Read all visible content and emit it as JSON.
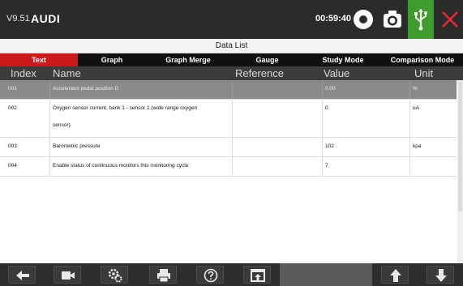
{
  "topbar": {
    "version": "V9.51",
    "make": "AUDI",
    "time": "00:59:40"
  },
  "title": "Data List",
  "tabs": [
    {
      "label": "Text",
      "active": true
    },
    {
      "label": "Graph",
      "active": false
    },
    {
      "label": "Graph Merge",
      "active": false
    },
    {
      "label": "Gauge",
      "active": false
    },
    {
      "label": "Study Mode",
      "active": false
    },
    {
      "label": "Comparison Mode",
      "active": false
    }
  ],
  "table": {
    "columns": [
      "Index",
      "Name",
      "Reference",
      "Value",
      "Unit"
    ],
    "rows": [
      {
        "index": "001",
        "name_lines": [
          "Accelerator pedal position D"
        ],
        "reference": "",
        "value": "0.00",
        "unit": "%",
        "selected": true
      },
      {
        "index": "002",
        "name_lines": [
          "Oxygen sensor current, bank 1 - sensor 1 (wide range oxygen",
          "sensor)."
        ],
        "reference": "",
        "value": "0",
        "unit": "uA",
        "selected": false
      },
      {
        "index": "003",
        "name_lines": [
          "Barometric pressure"
        ],
        "reference": "",
        "value": "102",
        "unit": "kpa",
        "selected": false
      },
      {
        "index": "004",
        "name_lines": [
          "Enable status of continuous monitors this monitoring cycle:"
        ],
        "reference": "",
        "value": "7",
        "unit": "",
        "selected": false
      }
    ]
  },
  "toolbar": {
    "icons": [
      "back-icon",
      "video-icon",
      "settings-icon",
      "print-icon",
      "help-icon",
      "save-icon",
      "scroll-up-icon",
      "scroll-down-icon"
    ]
  },
  "colors": {
    "topbar": "#2b2b2b",
    "tab_active": "#cc1a1a",
    "usb_green": "#3d9c2a",
    "close_red": "#e8282e",
    "selected_row": "#8a8a8a"
  }
}
